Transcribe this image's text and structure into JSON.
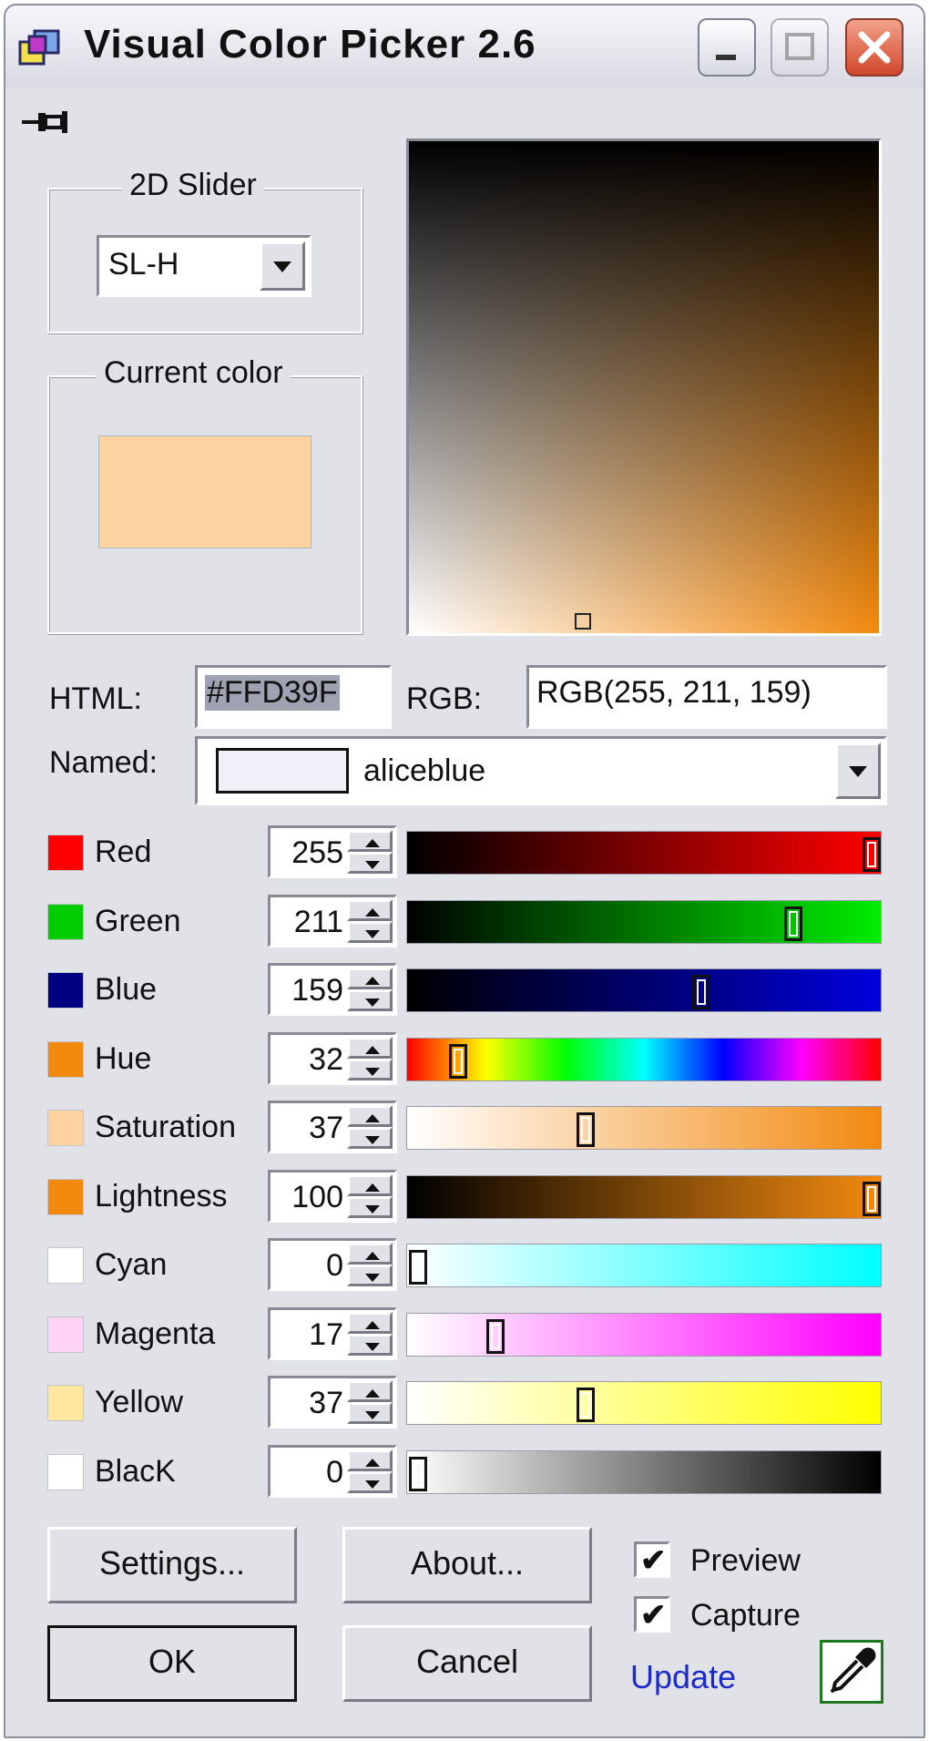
{
  "window": {
    "title": "Visual Color Picker 2.6"
  },
  "slider2d": {
    "label": "2D Slider",
    "mode": "SL-H",
    "marker_saturation": 37,
    "marker_lightness": 100
  },
  "current": {
    "label": "Current color",
    "color": "#FFD39F"
  },
  "html": {
    "label": "HTML:",
    "value": "#FFD39F"
  },
  "rgb": {
    "label": "RGB:",
    "value": "RGB(255, 211, 159)"
  },
  "named": {
    "label": "Named:",
    "value": "aliceblue",
    "swatch": "#F0F0F8"
  },
  "channels": [
    {
      "name": "Red",
      "value": "255",
      "level": 1.0,
      "swatch": "#FF0000",
      "gradient": [
        "#000000",
        "#FF0000"
      ]
    },
    {
      "name": "Green",
      "value": "211",
      "level": 0.827,
      "swatch": "#00CC00",
      "gradient": [
        "#000000",
        "#00EE00"
      ]
    },
    {
      "name": "Blue",
      "value": "159",
      "level": 0.624,
      "swatch": "#000080",
      "gradient": [
        "#000000",
        "#0000DD"
      ]
    },
    {
      "name": "Hue",
      "value": "32",
      "level": 0.089,
      "swatch": "#F28A10",
      "gradient": [
        "#FF0000",
        "#FFFF00",
        "#00FF00",
        "#00FFFF",
        "#0000FF",
        "#FF00FF",
        "#FF0000"
      ]
    },
    {
      "name": "Saturation",
      "value": "37",
      "level": 0.37,
      "swatch": "#FFD39F",
      "gradient": [
        "#FFFFFF",
        "#F28A10"
      ]
    },
    {
      "name": "Lightness",
      "value": "100",
      "level": 1.0,
      "swatch": "#F28A10",
      "gradient": [
        "#000000",
        "#F28A10"
      ]
    },
    {
      "name": "Cyan",
      "value": "0",
      "level": 0.0,
      "swatch": "#FFFFFF",
      "gradient": [
        "#FFFFFF",
        "#00FFFF"
      ]
    },
    {
      "name": "Magenta",
      "value": "17",
      "level": 0.17,
      "swatch": "#FFD3F5",
      "gradient": [
        "#FFFFFF",
        "#FF00FF"
      ]
    },
    {
      "name": "Yellow",
      "value": "37",
      "level": 0.37,
      "swatch": "#FFE7A0",
      "gradient": [
        "#FFFFFF",
        "#FFFF00"
      ]
    },
    {
      "name": "BlacK",
      "value": "0",
      "level": 0.0,
      "swatch": "#FFFFFF",
      "gradient": [
        "#FFFFFF",
        "#000000"
      ]
    }
  ],
  "buttons": {
    "settings": "Settings...",
    "about": "About...",
    "ok": "OK",
    "cancel": "Cancel"
  },
  "options": {
    "preview": "Preview",
    "capture": "Capture",
    "preview_checked": true,
    "capture_checked": true
  },
  "update_link": "Update",
  "icons": {
    "minimize": "minimize-icon",
    "maximize": "maximize-icon",
    "close": "close-icon",
    "pin": "pin-icon",
    "eyedropper": "eyedropper-icon"
  }
}
